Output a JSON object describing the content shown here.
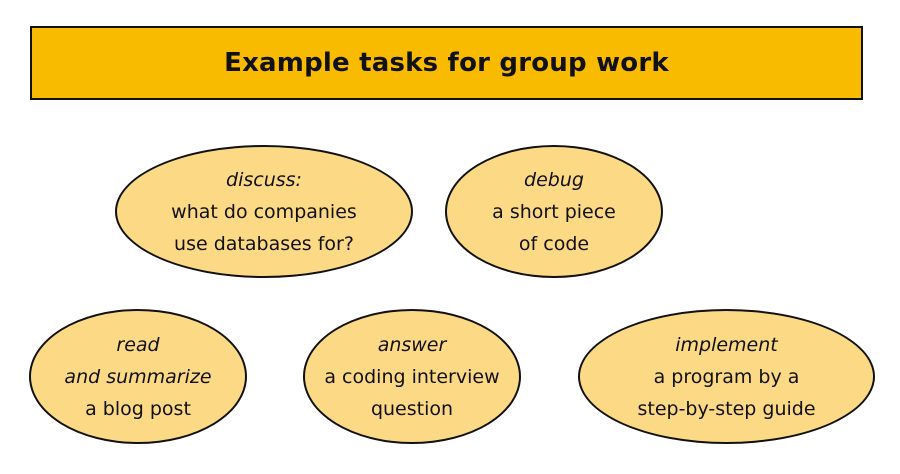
{
  "colors": {
    "banner_fill": "#f8bb00",
    "bubble_fill": "#fbd985",
    "outline": "#111111"
  },
  "title": "Example tasks for group work",
  "tasks": [
    {
      "id": "discuss",
      "verb": "discuss:",
      "lines": [
        "what do companies",
        "use databases for?"
      ]
    },
    {
      "id": "debug",
      "verb": "debug",
      "lines": [
        "a short piece",
        "of code"
      ]
    },
    {
      "id": "read",
      "verb": "read",
      "lines": [
        "and summarize",
        "a blog post"
      ]
    },
    {
      "id": "answer",
      "verb": "answer",
      "lines": [
        "a coding interview",
        "question"
      ]
    },
    {
      "id": "implement",
      "verb": "implement",
      "lines": [
        "a program by a",
        "step-by-step guide"
      ]
    }
  ]
}
